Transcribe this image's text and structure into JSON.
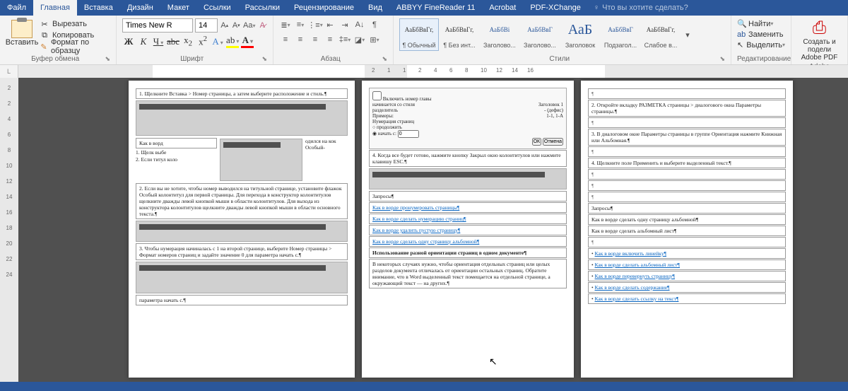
{
  "menu": {
    "file": "Файл",
    "home": "Главная",
    "insert": "Вставка",
    "design": "Дизайн",
    "layout": "Макет",
    "references": "Ссылки",
    "mailings": "Рассылки",
    "review": "Рецензирование",
    "view": "Вид",
    "finereader": "ABBYY FineReader 11",
    "acrobat": "Acrobat",
    "pdfx": "PDF-XChange",
    "tellme": "Что вы хотите сделать?"
  },
  "clipboard": {
    "paste": "Вставить",
    "cut": "Вырезать",
    "copy": "Копировать",
    "format": "Формат по образцу",
    "label": "Буфер обмена"
  },
  "font": {
    "name": "Times New R",
    "size": "14",
    "label": "Шрифт"
  },
  "para": {
    "label": "Абзац"
  },
  "styles": {
    "label": "Стили",
    "items": [
      {
        "sample": "АаБбВвГг,",
        "name": "¶ Обычный"
      },
      {
        "sample": "АаБбВвГг,",
        "name": "¶ Без инт..."
      },
      {
        "sample": "АаБбВі",
        "name": "Заголово...",
        "h": true
      },
      {
        "sample": "АаБбВвГ",
        "name": "Заголово...",
        "h": true
      },
      {
        "sample": "АаБ",
        "name": "Заголовок",
        "big": true
      },
      {
        "sample": "АаБбВвГ",
        "name": "Подзагол...",
        "h": true
      },
      {
        "sample": "АаБбВвГг,",
        "name": "Слабое в..."
      }
    ]
  },
  "editing": {
    "find": "Найти",
    "replace": "Заменить",
    "select": "Выделить",
    "label": "Редактирование"
  },
  "pdf": {
    "create": "Создать и подели",
    "label": "Adobe PDF",
    "footer": "Adobe"
  },
  "ruler": {
    "marks": [
      "2",
      "1",
      "1",
      "2",
      "4",
      "6",
      "8",
      "10",
      "12",
      "14",
      "16"
    ]
  },
  "vruler": [
    "2",
    "2",
    "4",
    "6",
    "8",
    "10",
    "12",
    "14",
    "16",
    "18",
    "20",
    "22",
    "24"
  ],
  "page1": {
    "l1": "1. Щелкните Вставка > Номер страницы, а затем выберите расположение и стиль.¶",
    "l2": "Как в ворд",
    "l3": "1. Щелк выбе",
    "l4": "2. Если титул коло",
    "l5": "одился на кок Особый-",
    "l6": "2. Если вы не хотите, чтобы номер выводился на титульной странице, установите флажок Особый колонтитул для первой страницы. Для перехода в конструктор колонтитулов щелкните дважды левой кнопкой мыши в области колонтитулов. Для выхода из конструктора колонтитулов щелкните дважды левой кнопкой мыши в области основного текста.¶",
    "l7": "3. Чтобы нумерация начиналась с 1 на второй странице, выберите Номер страницы > Формат номеров страниц и задайте значение 0 для параметра начать с.¶",
    "l8": "параметра начать с.¶"
  },
  "page2": {
    "chk": "Включить номер главы",
    "opt1": "начинается со стиля",
    "opt1v": "Заголовок 1",
    "opt2": "разделитель",
    "opt2v": "- (дефис)",
    "opt3": "Примеры:",
    "opt3v": "1-1, 1-A",
    "sec": "Нумерация страниц",
    "r1": "продолжить",
    "r2": "начать с:",
    "r2v": "0",
    "ok": "ОК",
    "cancel": "Отмена",
    "l1": "4. Когда все будет готово, нажмите кнопку Закрыл окно колонтитулов или нажмите клавишу ESC.¶",
    "q": "Запросы¶",
    "links": [
      "Как в ворде пронумеровать страницы¶",
      "Как в ворде сделать нумерацию страниц¶",
      "Как в ворде удалить пустую страницу¶",
      "Как в ворде сделать одну страницу альбомной¶"
    ],
    "h": "Использование разной ориентации страниц в одном документе¶",
    "t": "В некоторых случаях нужно, чтобы ориентация отдельных страниц или целых разделов документа отличалась от ориентации остальных страниц. Обратите внимание, что в Word выделенный текст помещается на отдельной странице, а окружающий текст — на других.¶"
  },
  "page3": {
    "l1": "2. Откройте вкладку РАЗМЕТКА страницы > диалогового окна Параметры страницы.¶",
    "l2": "3. В диалоговом окне Параметры страницы в группе Ориентация нажмите Книжная или Альбомная.¶",
    "l3": "4. Щелкните поле Применить и выберите выделенный текст.¶",
    "q": "Запросы¶",
    "q1": "Как в ворде сделать одну страницу альбомной¶",
    "q2": "Как в ворде сделать альбомный лист¶",
    "links": [
      "Как в ворде включить линейку¶",
      "Как в ворде сделать альбомный лист¶",
      "Как в ворде перевернуть страницу¶",
      "Как в ворде сделать содержание¶",
      "Как в ворде сделать ссылку на текст¶"
    ]
  }
}
